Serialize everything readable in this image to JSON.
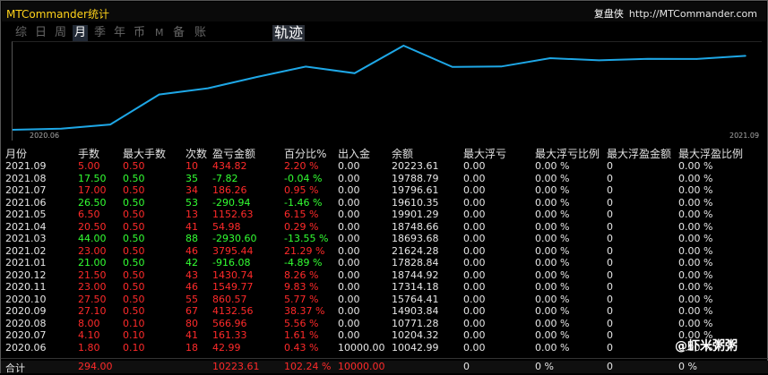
{
  "window": {
    "title": "MTCommander统计",
    "brand": "复盘侠",
    "url": "http://MTCommander.com"
  },
  "tabs": [
    {
      "label": "综",
      "active": false
    },
    {
      "label": "日",
      "active": false
    },
    {
      "label": "周",
      "active": false
    },
    {
      "label": "月",
      "active": true
    },
    {
      "label": "季",
      "active": false
    },
    {
      "label": "年",
      "active": false
    },
    {
      "label": "币",
      "active": false
    },
    {
      "label": "M",
      "active": false
    },
    {
      "label": "备",
      "active": false
    },
    {
      "label": "账户",
      "active": false
    }
  ],
  "track_button": "轨迹",
  "chart_data": {
    "type": "line",
    "x_labels": [
      "2020.06",
      "2021.09"
    ],
    "x": [
      "2020.06",
      "2020.07",
      "2020.08",
      "2020.09",
      "2020.10",
      "2020.11",
      "2020.12",
      "2021.01",
      "2021.02",
      "2021.03",
      "2021.04",
      "2021.05",
      "2021.06",
      "2021.07",
      "2021.08",
      "2021.09"
    ],
    "series": [
      {
        "values": [
          -0.43,
          160.3,
          726.0,
          4858.6,
          5719.2,
          7268.9,
          8699.6,
          7783.6,
          11579.1,
          8648.5,
          8703.4,
          9855.9,
          9565.0,
          9751.2,
          9743.4,
          10177.8
        ]
      }
    ],
    "color": "#1ea7e6"
  },
  "table": {
    "headers": [
      "月份",
      "手数",
      "最大手数",
      "次数",
      "盈亏金额",
      "百分比%",
      "出入金",
      "余额",
      "最大浮亏",
      "最大浮亏比例",
      "最大浮盈金额",
      "最大浮盈比例"
    ],
    "rows": [
      {
        "month": "2021.09",
        "lots": "5.00",
        "max_lots": "0.50",
        "count": "10",
        "pnl": "434.82",
        "pct": "2.20 %",
        "io": "0.00",
        "balance": "20223.61",
        "max_loss": "0.00",
        "max_loss_pct": "0.00 %",
        "max_gain": "0",
        "max_gain_pct": "0.00 %",
        "tone": "r"
      },
      {
        "month": "2021.08",
        "lots": "17.50",
        "max_lots": "0.50",
        "count": "35",
        "pnl": "-7.82",
        "pct": "-0.04 %",
        "io": "0.00",
        "balance": "19788.79",
        "max_loss": "0.00",
        "max_loss_pct": "0.00 %",
        "max_gain": "0",
        "max_gain_pct": "0.00 %",
        "tone": "g"
      },
      {
        "month": "2021.07",
        "lots": "17.00",
        "max_lots": "0.50",
        "count": "34",
        "pnl": "186.26",
        "pct": "0.95 %",
        "io": "0.00",
        "balance": "19796.61",
        "max_loss": "0.00",
        "max_loss_pct": "0.00 %",
        "max_gain": "0",
        "max_gain_pct": "0.00 %",
        "tone": "r"
      },
      {
        "month": "2021.06",
        "lots": "26.50",
        "max_lots": "0.50",
        "count": "53",
        "pnl": "-290.94",
        "pct": "-1.46 %",
        "io": "0.00",
        "balance": "19610.35",
        "max_loss": "0.00",
        "max_loss_pct": "0.00 %",
        "max_gain": "0",
        "max_gain_pct": "0.00 %",
        "tone": "g"
      },
      {
        "month": "2021.05",
        "lots": "6.50",
        "max_lots": "0.50",
        "count": "13",
        "pnl": "1152.63",
        "pct": "6.15 %",
        "io": "0.00",
        "balance": "19901.29",
        "max_loss": "0.00",
        "max_loss_pct": "0.00 %",
        "max_gain": "0",
        "max_gain_pct": "0.00 %",
        "tone": "r"
      },
      {
        "month": "2021.04",
        "lots": "20.50",
        "max_lots": "0.50",
        "count": "41",
        "pnl": "54.98",
        "pct": "0.29 %",
        "io": "0.00",
        "balance": "18748.66",
        "max_loss": "0.00",
        "max_loss_pct": "0.00 %",
        "max_gain": "0",
        "max_gain_pct": "0.00 %",
        "tone": "r"
      },
      {
        "month": "2021.03",
        "lots": "44.00",
        "max_lots": "0.50",
        "count": "88",
        "pnl": "-2930.60",
        "pct": "-13.55 %",
        "io": "0.00",
        "balance": "18693.68",
        "max_loss": "0.00",
        "max_loss_pct": "0.00 %",
        "max_gain": "0",
        "max_gain_pct": "0.00 %",
        "tone": "g"
      },
      {
        "month": "2021.02",
        "lots": "23.00",
        "max_lots": "0.50",
        "count": "46",
        "pnl": "3795.44",
        "pct": "21.29 %",
        "io": "0.00",
        "balance": "21624.28",
        "max_loss": "0.00",
        "max_loss_pct": "0.00 %",
        "max_gain": "0",
        "max_gain_pct": "0.00 %",
        "tone": "r"
      },
      {
        "month": "2021.01",
        "lots": "21.00",
        "max_lots": "0.50",
        "count": "42",
        "pnl": "-916.08",
        "pct": "-4.89 %",
        "io": "0.00",
        "balance": "17828.84",
        "max_loss": "0.00",
        "max_loss_pct": "0.00 %",
        "max_gain": "0",
        "max_gain_pct": "0.00 %",
        "tone": "g"
      },
      {
        "month": "2020.12",
        "lots": "21.50",
        "max_lots": "0.50",
        "count": "43",
        "pnl": "1430.74",
        "pct": "8.26 %",
        "io": "0.00",
        "balance": "18744.92",
        "max_loss": "0.00",
        "max_loss_pct": "0.00 %",
        "max_gain": "0",
        "max_gain_pct": "0.00 %",
        "tone": "r"
      },
      {
        "month": "2020.11",
        "lots": "23.00",
        "max_lots": "0.50",
        "count": "46",
        "pnl": "1549.77",
        "pct": "9.83 %",
        "io": "0.00",
        "balance": "17314.18",
        "max_loss": "0.00",
        "max_loss_pct": "0.00 %",
        "max_gain": "0",
        "max_gain_pct": "0.00 %",
        "tone": "r"
      },
      {
        "month": "2020.10",
        "lots": "27.50",
        "max_lots": "0.50",
        "count": "55",
        "pnl": "860.57",
        "pct": "5.77 %",
        "io": "0.00",
        "balance": "15764.41",
        "max_loss": "0.00",
        "max_loss_pct": "0.00 %",
        "max_gain": "0",
        "max_gain_pct": "0.00 %",
        "tone": "r"
      },
      {
        "month": "2020.09",
        "lots": "27.10",
        "max_lots": "0.50",
        "count": "67",
        "pnl": "4132.56",
        "pct": "38.37 %",
        "io": "0.00",
        "balance": "14903.84",
        "max_loss": "0.00",
        "max_loss_pct": "0.00 %",
        "max_gain": "0",
        "max_gain_pct": "0.00 %",
        "tone": "r"
      },
      {
        "month": "2020.08",
        "lots": "8.00",
        "max_lots": "0.10",
        "count": "80",
        "pnl": "566.96",
        "pct": "5.56 %",
        "io": "0.00",
        "balance": "10771.28",
        "max_loss": "0.00",
        "max_loss_pct": "0.00 %",
        "max_gain": "0",
        "max_gain_pct": "0.00 %",
        "tone": "r"
      },
      {
        "month": "2020.07",
        "lots": "4.10",
        "max_lots": "0.10",
        "count": "41",
        "pnl": "161.33",
        "pct": "1.61 %",
        "io": "0.00",
        "balance": "10204.32",
        "max_loss": "0.00",
        "max_loss_pct": "0.00 %",
        "max_gain": "0",
        "max_gain_pct": "0.00 %",
        "tone": "r"
      },
      {
        "month": "2020.06",
        "lots": "1.80",
        "max_lots": "0.10",
        "count": "18",
        "pnl": "42.99",
        "pct": "0.43 %",
        "io": "10000.00",
        "balance": "10042.99",
        "max_loss": "0.00",
        "max_loss_pct": "0.00 %",
        "max_gain": "0",
        "max_gain_pct": "0.00 %",
        "tone": "r"
      }
    ],
    "total": {
      "label": "合计",
      "lots": "294.00",
      "pnl": "10223.61",
      "pct": "102.24 %",
      "io": "10000.00",
      "max_loss": "0",
      "max_loss_pct": "0 %",
      "max_gain": "0",
      "max_gain_pct": "0 %"
    }
  },
  "watermark": "@虾米粥粥",
  "colors": {
    "title": "#ffd21a",
    "loss": "#33ff33",
    "profit": "#ff2a2a",
    "line": "#1ea7e6"
  }
}
